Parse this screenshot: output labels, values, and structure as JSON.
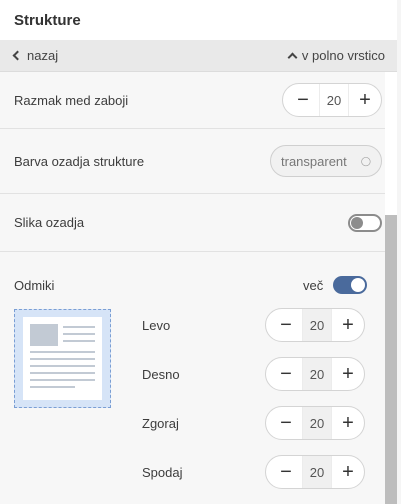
{
  "panel": {
    "title": "Strukture"
  },
  "subbar": {
    "back_label": "nazaj",
    "fullrow_label": "v polno vrstico"
  },
  "settings": {
    "spacing": {
      "label": "Razmak med zaboji",
      "value": "20",
      "minus": "−",
      "plus": "+"
    },
    "bg_color": {
      "label": "Barva ozadja strukture",
      "value": "transparent"
    },
    "bg_image": {
      "label": "Slika ozadja",
      "enabled": false
    }
  },
  "margins": {
    "label": "Odmiki",
    "more_label": "več",
    "more_enabled": true,
    "items": [
      {
        "label": "Levo",
        "value": "20"
      },
      {
        "label": "Desno",
        "value": "20"
      },
      {
        "label": "Zgoraj",
        "value": "20"
      },
      {
        "label": "Spodaj",
        "value": "20"
      }
    ],
    "minus": "−",
    "plus": "+"
  },
  "colors": {
    "toggle_on": "#4a6a9c",
    "toggle_off": "#8c8c8c",
    "preview_bg": "#d6e4f7"
  }
}
